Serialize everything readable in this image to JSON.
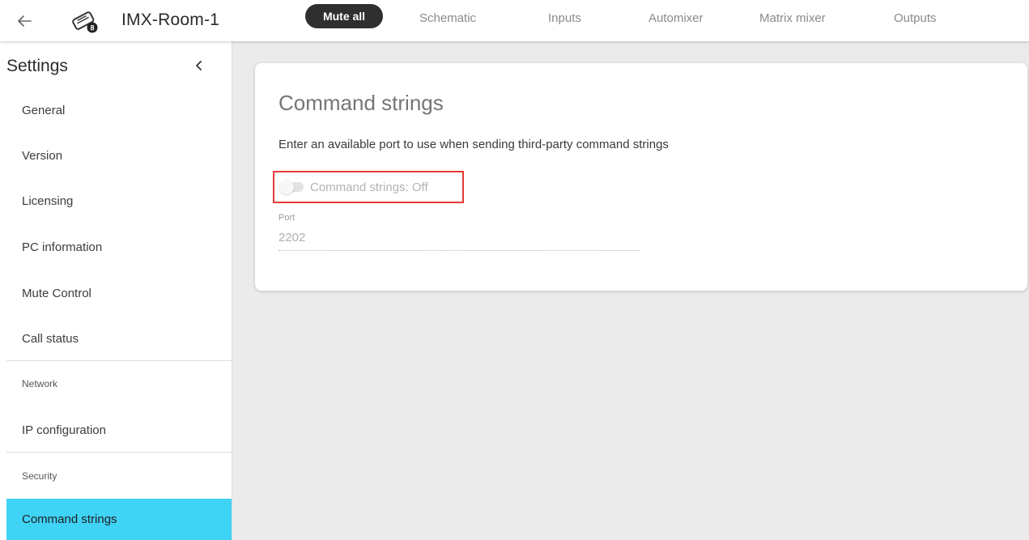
{
  "header": {
    "device_name": "IMX-Room-1",
    "mute_all_label": "Mute all",
    "tabs": [
      {
        "label": "Schematic"
      },
      {
        "label": "Inputs"
      },
      {
        "label": "Automixer"
      },
      {
        "label": "Matrix mixer"
      },
      {
        "label": "Outputs"
      }
    ],
    "icons": {
      "back": "back-arrow-icon",
      "device": "device-icon",
      "device_badge": "8"
    }
  },
  "sidebar": {
    "title": "Settings",
    "collapse_icon": "chevron-left-icon",
    "items": [
      {
        "label": "General"
      },
      {
        "label": "Version"
      },
      {
        "label": "Licensing"
      },
      {
        "label": "PC information"
      },
      {
        "label": "Mute Control"
      },
      {
        "label": "Call status"
      }
    ],
    "network_section": "Network",
    "network_items": [
      {
        "label": "IP configuration"
      }
    ],
    "security_section": "Security",
    "security_items": [
      {
        "label": "Command strings",
        "active": true
      }
    ]
  },
  "main": {
    "title": "Command strings",
    "description": "Enter an available port to use when sending third-party command strings",
    "toggle_label": "Command strings: Off",
    "toggle_state": "off",
    "port_label": "Port",
    "port_value": "2202"
  },
  "colors": {
    "active_item": "#3fd3f6",
    "highlight_border": "#e53935",
    "mute_button": "#2f2f2f"
  }
}
